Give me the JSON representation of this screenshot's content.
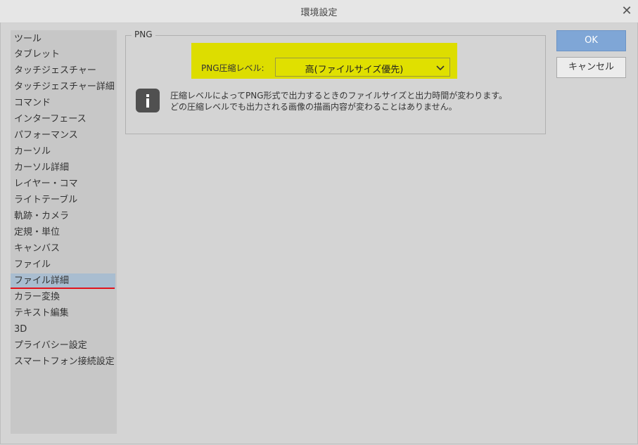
{
  "window": {
    "title": "環境設定"
  },
  "sidebar": {
    "items": [
      {
        "label": "ツール"
      },
      {
        "label": "タブレット"
      },
      {
        "label": "タッチジェスチャー"
      },
      {
        "label": "タッチジェスチャー詳細"
      },
      {
        "label": "コマンド"
      },
      {
        "label": "インターフェース"
      },
      {
        "label": "パフォーマンス"
      },
      {
        "label": "カーソル"
      },
      {
        "label": "カーソル詳細"
      },
      {
        "label": "レイヤー・コマ"
      },
      {
        "label": "ライトテーブル"
      },
      {
        "label": "軌跡・カメラ"
      },
      {
        "label": "定規・単位"
      },
      {
        "label": "キャンバス"
      },
      {
        "label": "ファイル"
      },
      {
        "label": "ファイル詳細"
      },
      {
        "label": "カラー変換"
      },
      {
        "label": "テキスト編集"
      },
      {
        "label": "3D"
      },
      {
        "label": "プライバシー設定"
      },
      {
        "label": "スマートフォン接続設定"
      }
    ],
    "selected_label": "ファイル詳細"
  },
  "png_group": {
    "legend": "PNG",
    "compression_label": "PNG圧縮レベル:",
    "compression_value": "高(ファイルサイズ優先)",
    "info_line1": "圧縮レベルによってPNG形式で出力するときのファイルサイズと出力時間が変わります。",
    "info_line2": "どの圧縮レベルでも出力される画像の描画内容が変わることはありません。"
  },
  "buttons": {
    "ok": "OK",
    "cancel": "キャンセル"
  },
  "icons": {
    "close": "close-icon",
    "info": "info-icon",
    "dropdown": "chevron-down-icon"
  },
  "colors": {
    "highlight": "#dddd00",
    "selection": "#a9bdd0",
    "selection_underline": "#e0141e",
    "ok_button": "#7fa6d6"
  }
}
